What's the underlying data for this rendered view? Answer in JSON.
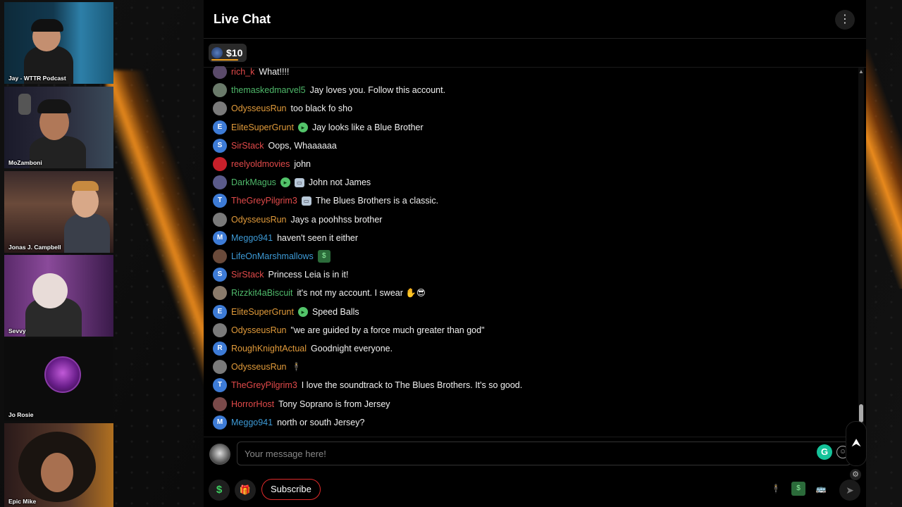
{
  "participants": [
    {
      "name": "Jay - WTTR Podcast"
    },
    {
      "name": "MoZamboni"
    },
    {
      "name": "Jonas J. Campbell"
    },
    {
      "name": "Sevvy"
    },
    {
      "name": "Jo Rosie"
    },
    {
      "name": "Epic Mike"
    }
  ],
  "chat": {
    "title": "Live Chat",
    "menu_icon": "more-vertical-icon",
    "tip": {
      "amount": "$10",
      "progress": 0.6
    },
    "messages": [
      {
        "user": "rich_k",
        "text": "What!!!!",
        "user_color": "#e24a4a",
        "avatar": "",
        "avatar_color": "#5a4a6a"
      },
      {
        "user": "themaskedmarvel5",
        "text": "Jay loves you. Follow this account.",
        "user_color": "#4fb86a",
        "avatar": "",
        "avatar_color": "#6a7a6a"
      },
      {
        "user": "OdysseusRun",
        "text": "too black fo sho",
        "user_color": "#e09a3a",
        "avatar": "",
        "avatar_color": "#7a7a7a"
      },
      {
        "user": "EliteSuperGrunt",
        "text": "Jay looks like a Blue Brother",
        "user_color": "#e09a3a",
        "avatar": "E",
        "avatar_color": "#3d7bd6",
        "badge": true
      },
      {
        "user": "SirStack",
        "text": "Oops, Whaaaaaa",
        "user_color": "#e24a4a",
        "avatar": "S",
        "avatar_color": "#3d7bd6"
      },
      {
        "user": "reelyoldmovies",
        "text": "john",
        "user_color": "#e24a4a",
        "avatar": "",
        "avatar_color": "#c8202a"
      },
      {
        "user": "DarkMagus",
        "text": "John not James",
        "user_color": "#4fb86a",
        "avatar": "",
        "avatar_color": "#5a5a8a",
        "badge": true,
        "badge2": true
      },
      {
        "user": "TheGreyPilgrim3",
        "text": "The Blues Brothers is a classic.",
        "user_color": "#e24a4a",
        "avatar": "T",
        "avatar_color": "#3d7bd6",
        "badge2": true
      },
      {
        "user": "OdysseusRun",
        "text": "Jays a poohhss brother",
        "user_color": "#e09a3a",
        "avatar": "",
        "avatar_color": "#7a7a7a"
      },
      {
        "user": "Meggo941",
        "text": "haven't seen it either",
        "user_color": "#3d9ad6",
        "avatar": "M",
        "avatar_color": "#3d7bd6"
      },
      {
        "user": "LifeOnMarshmallows",
        "text": "",
        "user_color": "#3d9ad6",
        "avatar": "",
        "avatar_color": "#6a4a3a",
        "money_emote": true
      },
      {
        "user": "SirStack",
        "text": "Princess Leia is in it!",
        "user_color": "#e24a4a",
        "avatar": "S",
        "avatar_color": "#3d7bd6"
      },
      {
        "user": "Rizzkit4aBiscuit",
        "text": "it's not my account. I swear ✋😎",
        "user_color": "#4fb86a",
        "avatar": "",
        "avatar_color": "#8a7a6a"
      },
      {
        "user": "EliteSuperGrunt",
        "text": "Speed Balls",
        "user_color": "#e09a3a",
        "avatar": "E",
        "avatar_color": "#3d7bd6",
        "badge": true
      },
      {
        "user": "OdysseusRun",
        "text": "\"we are guided by a force much greater than god\"",
        "user_color": "#e09a3a",
        "avatar": "",
        "avatar_color": "#7a7a7a"
      },
      {
        "user": "RoughKnightActual",
        "text": "Goodnight everyone.",
        "user_color": "#e09a3a",
        "avatar": "R",
        "avatar_color": "#3d7bd6"
      },
      {
        "user": "OdysseusRun",
        "text": "",
        "user_color": "#e09a3a",
        "avatar": "",
        "avatar_color": "#7a7a7a",
        "figure_emote": true
      },
      {
        "user": "TheGreyPilgrim3",
        "text": "I love the soundtrack to The Blues Brothers. It's so good.",
        "user_color": "#e24a4a",
        "avatar": "T",
        "avatar_color": "#3d7bd6"
      },
      {
        "user": "HorrorHost",
        "text": "Tony Soprano is from Jersey",
        "user_color": "#e24a4a",
        "avatar": "",
        "avatar_color": "#7a4a4a"
      },
      {
        "user": "Meggo941",
        "text": "north or south Jersey?",
        "user_color": "#3d9ad6",
        "avatar": "M",
        "avatar_color": "#3d7bd6"
      }
    ],
    "composer": {
      "placeholder": "Your message here!",
      "value": ""
    },
    "toolbar": {
      "tip_label": "$",
      "gift_label": "🎁",
      "subscribe_label": "Subscribe",
      "send_icon": "send-icon"
    },
    "scroll": {
      "position": 0.95
    }
  },
  "colors": {
    "accent_red": "#e02a2a",
    "accent_green": "#2f9e4a",
    "username_orange": "#e09a3a",
    "username_red": "#e24a4a",
    "username_green": "#4fb86a",
    "username_blue": "#3d9ad6"
  }
}
